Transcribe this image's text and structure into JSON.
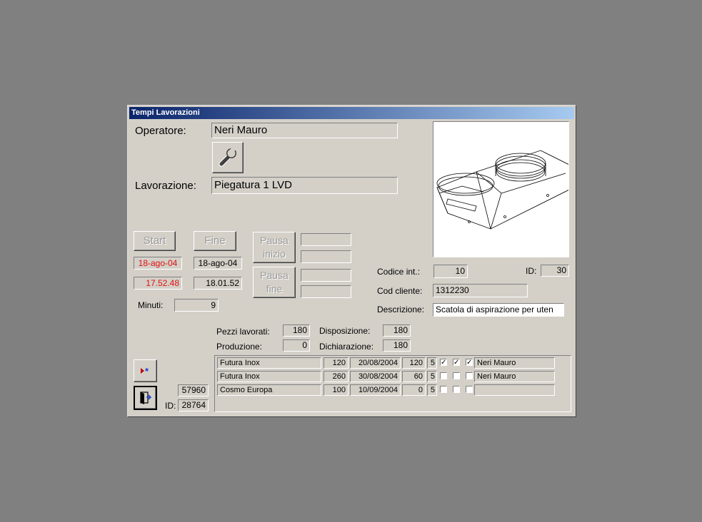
{
  "window": {
    "title": "Tempi Lavorazioni"
  },
  "operatore": {
    "label": "Operatore:",
    "value": "Neri Mauro"
  },
  "lavorazione": {
    "label": "Lavorazione:",
    "value": "Piegatura 1 LVD"
  },
  "buttons": {
    "start": "Start",
    "fine": "Fine",
    "pausa_inizio": "Pausa inizio",
    "pausa_fine": "Pausa fine"
  },
  "start": {
    "date": "18-ago-04",
    "time": "17.52.48"
  },
  "fine": {
    "date": "18-ago-04",
    "time": "18.01.52"
  },
  "minuti": {
    "label": "Minuti:",
    "value": "9"
  },
  "codice_int": {
    "label": "Codice  int.:",
    "value": "10"
  },
  "id_top": {
    "label": "ID:",
    "value": "30"
  },
  "cod_cliente": {
    "label": "Cod cliente:",
    "value": "1312230"
  },
  "descrizione": {
    "label": "Descrizione:",
    "value": "Scatola di aspirazione per uten"
  },
  "pezzi_lavorati": {
    "label": "Pezzi lavorati:",
    "value": "180"
  },
  "produzione": {
    "label": "Produzione:",
    "value": "0"
  },
  "disposizione": {
    "label": "Disposizione:",
    "value": "180"
  },
  "dichiarazione": {
    "label": "Dichiarazione:",
    "value": "180"
  },
  "bottom": {
    "num": "57960",
    "id_label": "ID:",
    "id_value": "28764"
  },
  "rows": [
    {
      "cliente": "Futura Inox",
      "qta": "120",
      "data": "20/08/2004",
      "q2": "120",
      "n": "5",
      "c1": true,
      "c2": true,
      "c3": true,
      "op": "Neri Mauro"
    },
    {
      "cliente": "Futura Inox",
      "qta": "260",
      "data": "30/08/2004",
      "q2": "60",
      "n": "5",
      "c1": false,
      "c2": false,
      "c3": false,
      "op": "Neri Mauro"
    },
    {
      "cliente": "Cosmo Europa",
      "qta": "100",
      "data": "10/09/2004",
      "q2": "0",
      "n": "5",
      "c1": false,
      "c2": false,
      "c3": false,
      "op": ""
    }
  ],
  "icons": {
    "tool": "wrench-icon",
    "new": "new-record-icon",
    "exit": "exit-door-icon"
  }
}
